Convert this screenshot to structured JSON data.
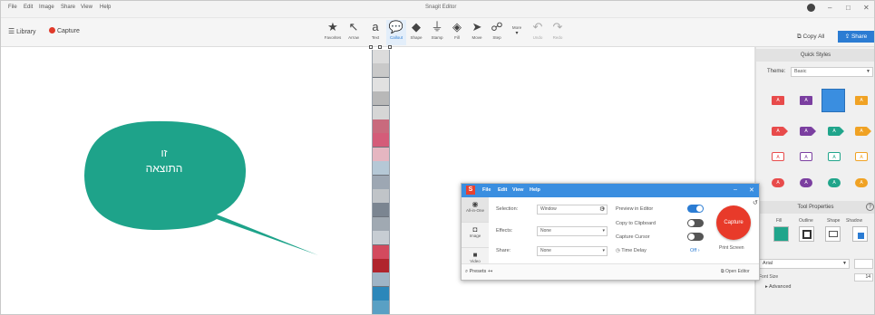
{
  "window": {
    "menus": [
      "File",
      "Edit",
      "Image",
      "Share",
      "View",
      "Help"
    ],
    "title": "Snagit Editor",
    "controls": {
      "minimize": "–",
      "maximize": "□",
      "close": "✕"
    }
  },
  "toolbar": {
    "library_label": "Library",
    "capture_label": "Capture",
    "tools": [
      {
        "label": "Favorites",
        "icon": "★"
      },
      {
        "label": "Arrow",
        "icon": "↖"
      },
      {
        "label": "Text",
        "icon": "a"
      },
      {
        "label": "Callout",
        "icon": "💬"
      },
      {
        "label": "Shape",
        "icon": "◆"
      },
      {
        "label": "Stamp",
        "icon": "⏚"
      },
      {
        "label": "Fill",
        "icon": "◈"
      },
      {
        "label": "Move",
        "icon": "➤"
      },
      {
        "label": "Step",
        "icon": "☍"
      },
      {
        "label": "More",
        "icon": "▾"
      },
      {
        "label": "Undo",
        "icon": "↶"
      },
      {
        "label": "Redo",
        "icon": "↷"
      }
    ],
    "copy_all_label": "Copy All",
    "share_label": "Share"
  },
  "canvas": {
    "callout_line1": "זו",
    "callout_line2": "התוצאה",
    "callout_color": "#1ea38a",
    "thumb_colors": [
      "#dcdcdc",
      "#c9c9c9",
      "#e1e1e1",
      "#b8b8b8",
      "#d6d6d6",
      "#c96a7d",
      "#d45c79",
      "#e5b6c1",
      "#b5c8d6",
      "#9da7b3",
      "#c0c4c8",
      "#7b8591",
      "#a0a9b2",
      "#c7cdd3",
      "#d34a5e",
      "#b0242d",
      "#9fb4c6",
      "#2c87ba",
      "#59a0c4"
    ]
  },
  "quick_styles": {
    "title": "Quick Styles",
    "theme_label": "Theme:",
    "theme_value": "Basic",
    "swatch_glyph": "A",
    "colors": [
      "#e84b4b",
      "#7b3fa0",
      "#20a58b",
      "#f0a224"
    ]
  },
  "tool_properties": {
    "title": "Tool Properties",
    "help": "?",
    "tabs": [
      "Fill",
      "Outline",
      "Shape",
      "Shadow"
    ],
    "fill_color": "#20a58b",
    "font_value": "Arial",
    "font_size_label": "Font Size",
    "font_size_value": "14",
    "advanced_label": "Advanced"
  },
  "capture_dialog": {
    "logo": "S",
    "menus": [
      "File",
      "Edit",
      "View",
      "Help"
    ],
    "window_controls": {
      "minimize": "–",
      "close": "✕"
    },
    "modes": [
      "All-in-One",
      "Image",
      "Video"
    ],
    "rows": [
      {
        "label": "Selection:",
        "value": "Window"
      },
      {
        "label": "Effects:",
        "value": "None"
      },
      {
        "label": "Share:",
        "value": "None"
      }
    ],
    "options": [
      {
        "label": "Preview in Editor",
        "on": true
      },
      {
        "label": "Copy to Clipboard",
        "on": false
      },
      {
        "label": "Capture Cursor",
        "on": false
      }
    ],
    "time_delay_label": "Time Delay",
    "time_delay_value": "Off",
    "capture_button": "Capture",
    "print_screen_label": "Print Screen",
    "presets_label": "Presets",
    "open_editor_label": "Open Editor",
    "accent": "#3a8ee0",
    "capture_color": "#e83a2a"
  }
}
